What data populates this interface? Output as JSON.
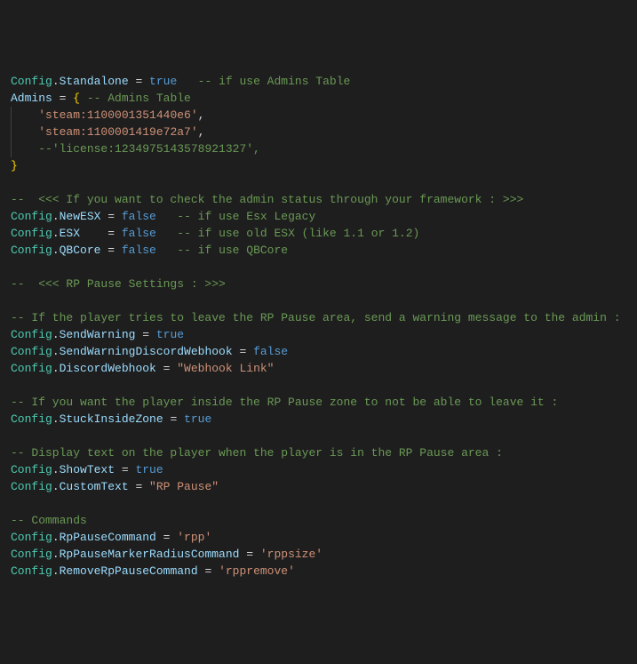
{
  "lines": [
    {
      "type": "code",
      "indent": 0,
      "tokens": [
        [
          "obj",
          "Config"
        ],
        [
          "punct",
          "."
        ],
        [
          "prop",
          "Standalone"
        ],
        [
          "punct",
          " = "
        ],
        [
          "bool",
          "true"
        ],
        [
          "comment",
          "   -- if use Admins Table"
        ]
      ]
    },
    {
      "type": "code",
      "indent": 0,
      "tokens": [
        [
          "prop",
          "Admins"
        ],
        [
          "punct",
          " = "
        ],
        [
          "brace",
          "{"
        ],
        [
          "comment",
          " -- Admins Table"
        ]
      ]
    },
    {
      "type": "code",
      "indent": 1,
      "tokens": [
        [
          "str",
          "'steam:1100001351440e6'"
        ],
        [
          "punct",
          ","
        ]
      ]
    },
    {
      "type": "code",
      "indent": 1,
      "tokens": [
        [
          "str",
          "'steam:1100001419e72a7'"
        ],
        [
          "punct",
          ","
        ]
      ]
    },
    {
      "type": "code",
      "indent": 1,
      "tokens": [
        [
          "comment",
          "--'license:1234975143578921327',"
        ]
      ]
    },
    {
      "type": "code",
      "indent": 0,
      "tokens": [
        [
          "brace",
          "}"
        ]
      ]
    },
    {
      "type": "blank"
    },
    {
      "type": "code",
      "indent": 0,
      "tokens": [
        [
          "comment",
          "--  <<< If you want to check the admin status through your framework : >>>"
        ]
      ]
    },
    {
      "type": "code",
      "indent": 0,
      "tokens": [
        [
          "obj",
          "Config"
        ],
        [
          "punct",
          "."
        ],
        [
          "prop",
          "NewESX"
        ],
        [
          "punct",
          " = "
        ],
        [
          "bool",
          "false"
        ],
        [
          "comment",
          "   -- if use Esx Legacy"
        ]
      ]
    },
    {
      "type": "code",
      "indent": 0,
      "tokens": [
        [
          "obj",
          "Config"
        ],
        [
          "punct",
          "."
        ],
        [
          "prop",
          "ESX"
        ],
        [
          "punct",
          "    = "
        ],
        [
          "bool",
          "false"
        ],
        [
          "comment",
          "   -- if use old ESX (like 1.1 or 1.2)"
        ]
      ]
    },
    {
      "type": "code",
      "indent": 0,
      "tokens": [
        [
          "obj",
          "Config"
        ],
        [
          "punct",
          "."
        ],
        [
          "prop",
          "QBCore"
        ],
        [
          "punct",
          " = "
        ],
        [
          "bool",
          "false"
        ],
        [
          "comment",
          "   -- if use QBCore"
        ]
      ]
    },
    {
      "type": "blank"
    },
    {
      "type": "code",
      "indent": 0,
      "tokens": [
        [
          "comment",
          "--  <<< RP Pause Settings : >>>"
        ]
      ]
    },
    {
      "type": "blank"
    },
    {
      "type": "code",
      "indent": 0,
      "tokens": [
        [
          "comment",
          "-- If the player tries to leave the RP Pause area, send a warning message to the admin :"
        ]
      ]
    },
    {
      "type": "code",
      "indent": 0,
      "tokens": [
        [
          "obj",
          "Config"
        ],
        [
          "punct",
          "."
        ],
        [
          "prop",
          "SendWarning"
        ],
        [
          "punct",
          " = "
        ],
        [
          "bool",
          "true"
        ]
      ]
    },
    {
      "type": "code",
      "indent": 0,
      "tokens": [
        [
          "obj",
          "Config"
        ],
        [
          "punct",
          "."
        ],
        [
          "prop",
          "SendWarningDiscordWebhook"
        ],
        [
          "punct",
          " = "
        ],
        [
          "bool",
          "false"
        ]
      ]
    },
    {
      "type": "code",
      "indent": 0,
      "tokens": [
        [
          "obj",
          "Config"
        ],
        [
          "punct",
          "."
        ],
        [
          "prop",
          "DiscordWebhook"
        ],
        [
          "punct",
          " = "
        ],
        [
          "str",
          "\"Webhook Link\""
        ]
      ]
    },
    {
      "type": "blank"
    },
    {
      "type": "code",
      "indent": 0,
      "tokens": [
        [
          "comment",
          "-- If you want the player inside the RP Pause zone to not be able to leave it :"
        ]
      ]
    },
    {
      "type": "code",
      "indent": 0,
      "tokens": [
        [
          "obj",
          "Config"
        ],
        [
          "punct",
          "."
        ],
        [
          "prop",
          "StuckInsideZone"
        ],
        [
          "punct",
          " = "
        ],
        [
          "bool",
          "true"
        ]
      ]
    },
    {
      "type": "blank"
    },
    {
      "type": "code",
      "indent": 0,
      "tokens": [
        [
          "comment",
          "-- Display text on the player when the player is in the RP Pause area :"
        ]
      ]
    },
    {
      "type": "code",
      "indent": 0,
      "tokens": [
        [
          "obj",
          "Config"
        ],
        [
          "punct",
          "."
        ],
        [
          "prop",
          "ShowText"
        ],
        [
          "punct",
          " = "
        ],
        [
          "bool",
          "true"
        ]
      ]
    },
    {
      "type": "code",
      "indent": 0,
      "tokens": [
        [
          "obj",
          "Config"
        ],
        [
          "punct",
          "."
        ],
        [
          "prop",
          "CustomText"
        ],
        [
          "punct",
          " = "
        ],
        [
          "str",
          "\"RP Pause\""
        ]
      ]
    },
    {
      "type": "blank"
    },
    {
      "type": "code",
      "indent": 0,
      "tokens": [
        [
          "comment",
          "-- Commands"
        ]
      ]
    },
    {
      "type": "code",
      "indent": 0,
      "tokens": [
        [
          "obj",
          "Config"
        ],
        [
          "punct",
          "."
        ],
        [
          "prop",
          "RpPauseCommand"
        ],
        [
          "punct",
          " = "
        ],
        [
          "str",
          "'rpp'"
        ]
      ]
    },
    {
      "type": "code",
      "indent": 0,
      "tokens": [
        [
          "obj",
          "Config"
        ],
        [
          "punct",
          "."
        ],
        [
          "prop",
          "RpPauseMarkerRadiusCommand"
        ],
        [
          "punct",
          " = "
        ],
        [
          "str",
          "'rppsize'"
        ]
      ]
    },
    {
      "type": "code",
      "indent": 0,
      "tokens": [
        [
          "obj",
          "Config"
        ],
        [
          "punct",
          "."
        ],
        [
          "prop",
          "RemoveRpPauseCommand"
        ],
        [
          "punct",
          " = "
        ],
        [
          "str",
          "'rppremove'"
        ]
      ]
    }
  ]
}
